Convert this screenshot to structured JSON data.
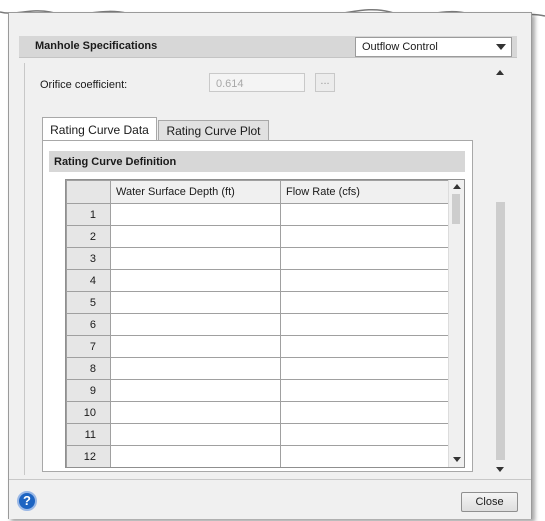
{
  "section": {
    "title": "Manhole Specifications",
    "dropdown_value": "Outflow Control"
  },
  "orifice": {
    "label": "Orifice coefficient:",
    "value": "0.614",
    "browse_label": "..."
  },
  "tabs": [
    {
      "label": "Rating Curve Data",
      "active": true
    },
    {
      "label": "Rating Curve Plot",
      "active": false
    }
  ],
  "definition": {
    "title": "Rating Curve Definition",
    "columns": [
      "Water Surface Depth (ft)",
      "Flow Rate (cfs)"
    ],
    "rows": [
      "1",
      "2",
      "3",
      "4",
      "5",
      "6",
      "7",
      "8",
      "9",
      "10",
      "11",
      "12"
    ]
  },
  "footer": {
    "help_label": "?",
    "close_label": "Close"
  },
  "icons": {
    "dropdown": "chevron-down-icon",
    "help": "help-icon"
  }
}
